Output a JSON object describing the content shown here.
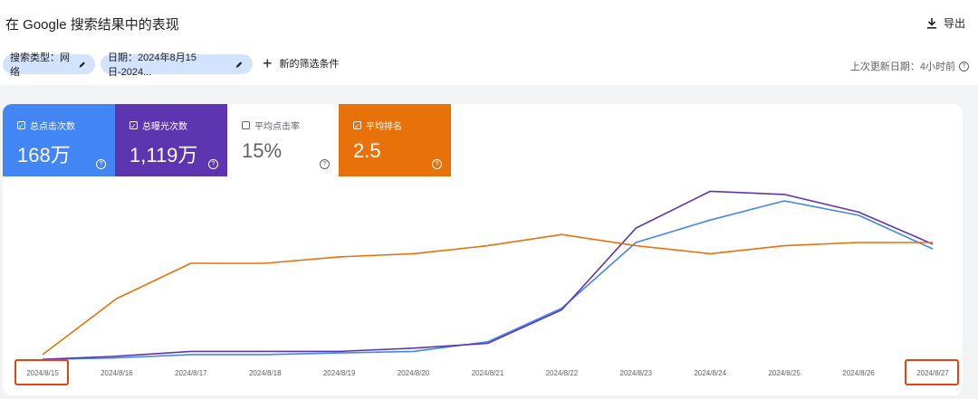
{
  "header": {
    "title": "在 Google 搜索结果中的表现",
    "export_label": "导出"
  },
  "filters": {
    "type_chip": "搜索类型：网络",
    "date_chip": "日期：2024年8月15日-2024...",
    "add_filter": "新的筛选条件",
    "updated": "上次更新日期：4小时前"
  },
  "metrics": [
    {
      "label": "总点击次数",
      "value": "168万",
      "checked": true,
      "color": "#4285f4"
    },
    {
      "label": "总曝光次数",
      "value": "1,119万",
      "checked": true,
      "color": "#5e35b1"
    },
    {
      "label": "平均点击率",
      "value": "15%",
      "checked": false,
      "color": "#ffffff"
    },
    {
      "label": "平均排名",
      "value": "2.5",
      "checked": true,
      "color": "#e8710a"
    }
  ],
  "chart_data": {
    "type": "line",
    "categories": [
      "2024/8/15",
      "2024/8/16",
      "2024/8/17",
      "2024/8/18",
      "2024/8/19",
      "2024/8/20",
      "2024/8/21",
      "2024/8/22",
      "2024/8/23",
      "2024/8/24",
      "2024/8/25",
      "2024/8/26",
      "2024/8/27"
    ],
    "highlighted_categories": [
      "2024/8/15",
      "2024/8/27"
    ],
    "ylim": [
      0,
      100
    ],
    "grid": false,
    "series": [
      {
        "color": "#4285f4",
        "values": [
          1,
          2,
          4,
          4,
          5,
          6,
          12,
          33,
          74,
          88,
          100,
          91,
          70
        ]
      },
      {
        "color": "#5e35b1",
        "values": [
          1,
          3,
          6,
          6,
          6,
          8,
          11,
          32,
          83,
          106,
          104,
          93,
          73
        ]
      },
      {
        "color": "#e8710a",
        "values": [
          4,
          39,
          61,
          61,
          65,
          67,
          72,
          79,
          72,
          67,
          72,
          74,
          74
        ]
      }
    ]
  }
}
